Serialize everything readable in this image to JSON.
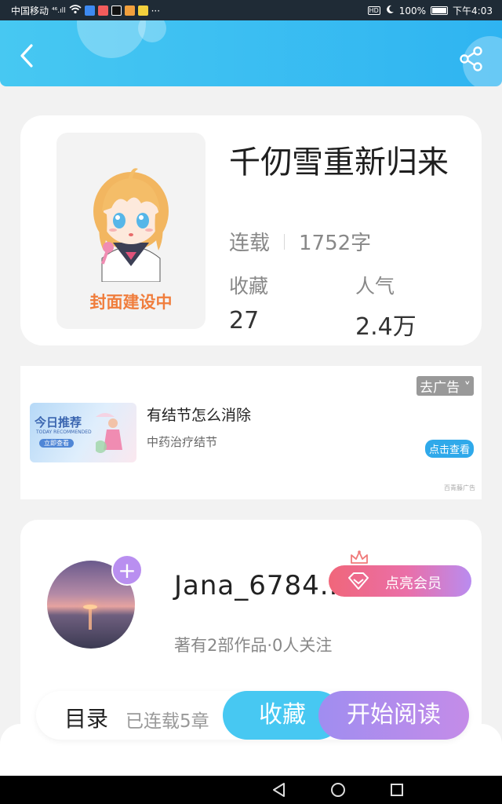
{
  "status_bar": {
    "carrier": "中国移动",
    "signal": "⁴⁶.ıll",
    "overflow": "···",
    "battery": "100%",
    "time": "下午4:03",
    "hd": "HD"
  },
  "book": {
    "cover_text": "封面建设中",
    "title": "千仞雪重新归来",
    "status": "连载",
    "word_count": "1752字",
    "favorites_label": "收藏",
    "favorites_value": "27",
    "popularity_label": "人气",
    "popularity_value": "2.4万"
  },
  "ad": {
    "close_label": "去广告 ˅",
    "image_title": "今日推荐",
    "image_subtitle": "TODAY RECOMMENDED",
    "image_button": "立即查看",
    "title": "有结节怎么消除",
    "subtitle": "中药治疗结节",
    "action": "点击查看",
    "source": "百青藤广告"
  },
  "author": {
    "name": "Jana_6784..",
    "follow_symbol": "+",
    "vip_label": "点亮会员",
    "stats": "著有2部作品·0人关注"
  },
  "bottom_bar": {
    "toc_label": "目录",
    "chapter_count": "已连载5章",
    "collect_label": "收藏",
    "read_label": "开始阅读"
  },
  "colors": {
    "header": "#47c8f2",
    "cover_text": "#f07d3c",
    "collect": "#47c8f2",
    "read": "#a08df0",
    "vip_start": "#f0667a",
    "vip_end": "#b98cf0"
  }
}
